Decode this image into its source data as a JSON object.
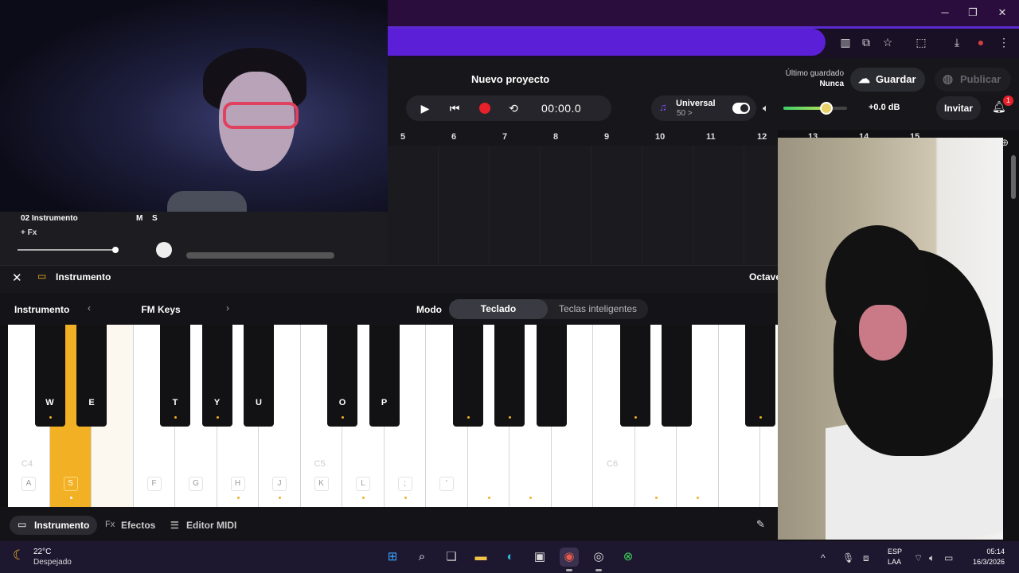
{
  "project": {
    "title": "Nuevo proyecto",
    "last_saved_label": "Último guardado",
    "last_saved_value": "Nunca"
  },
  "buttons": {
    "save": "Guardar",
    "publish": "Publicar",
    "invite": "Invitar"
  },
  "transport": {
    "time": "00:00.0"
  },
  "instrument_pill": {
    "name": "Universal",
    "value": "50 >"
  },
  "volume": {
    "db": "+0.0 dB",
    "level": 0.68
  },
  "notifications": {
    "count": "1"
  },
  "ruler": [
    "5",
    "6",
    "7",
    "8",
    "9",
    "10",
    "11",
    "12",
    "13",
    "14",
    "15"
  ],
  "track": {
    "name": "02 Instrumento",
    "fx": "+ Fx",
    "mute": "M",
    "solo": "S"
  },
  "panel": {
    "title": "Instrumento",
    "octave": "Octave",
    "instrument_label": "Instrumento",
    "instrument_value": "FM Keys",
    "mode_label": "Modo",
    "mode_keyboard": "Teclado",
    "mode_smart": "Teclas inteligentes"
  },
  "keyboard": {
    "white_keys": [
      {
        "label": "A",
        "oct": "C4"
      },
      {
        "label": "S",
        "active": true
      },
      {
        "label": ""
      },
      {
        "label": "F"
      },
      {
        "label": "G"
      },
      {
        "label": "H",
        "dot": true
      },
      {
        "label": "J",
        "dot": true
      },
      {
        "label": "K",
        "oct": "C5"
      },
      {
        "label": "L",
        "dot": true
      },
      {
        "label": ";",
        "dot": true
      },
      {
        "label": "'"
      },
      {
        "label": "",
        "dot": true
      },
      {
        "label": "",
        "dot": true
      },
      {
        "label": ""
      },
      {
        "label": "",
        "oct": "C6"
      },
      {
        "label": "",
        "dot": true
      },
      {
        "label": "",
        "dot": true
      },
      {
        "label": ""
      },
      {
        "label": ""
      }
    ],
    "black_keys": [
      {
        "label": "W",
        "dot": true
      },
      {
        "label": "E"
      },
      {
        "label": "T",
        "dot": true
      },
      {
        "label": "Y",
        "dot": true
      },
      {
        "label": "U"
      },
      {
        "label": "O",
        "dot": true
      },
      {
        "label": "P"
      },
      {
        "label": "",
        "dot": true
      },
      {
        "label": "",
        "dot": true
      },
      {
        "label": ""
      },
      {
        "label": "",
        "dot": true
      },
      {
        "label": ""
      },
      {
        "label": "",
        "dot": true
      }
    ]
  },
  "panel_tabs": {
    "instrument": "Instrumento",
    "effects": "Efectos",
    "midi": "Editor MIDI",
    "fx_prefix": "Fx"
  },
  "taskbar": {
    "temp": "22°C",
    "condition": "Despejado",
    "lang1": "ESP",
    "lang2": "LAA",
    "time": "05:14",
    "date": "16/3/2026"
  },
  "colors": {
    "accent": "#f2b124",
    "record": "#e8202a",
    "brand": "#5a1fd6"
  }
}
